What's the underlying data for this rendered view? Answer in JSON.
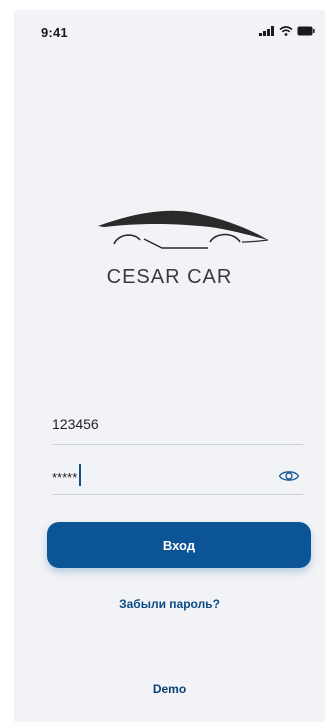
{
  "status_bar": {
    "time": "9:41",
    "icons": [
      "cellular-signal-icon",
      "wifi-icon",
      "battery-icon"
    ]
  },
  "brand": {
    "logo_icon": "sports-car-icon",
    "name": "CESAR CAR"
  },
  "login_form": {
    "login_value": "123456",
    "password_mask": "*****",
    "password_toggle_icon": "eye-icon",
    "submit_label": "Вход",
    "forgot_password_label": "Забыли пароль?",
    "demo_label": "Demo"
  },
  "colors": {
    "background": "#f2f3f7",
    "primary": "#0b5596",
    "link": "#0b4a85",
    "divider": "#cfd2d8"
  }
}
